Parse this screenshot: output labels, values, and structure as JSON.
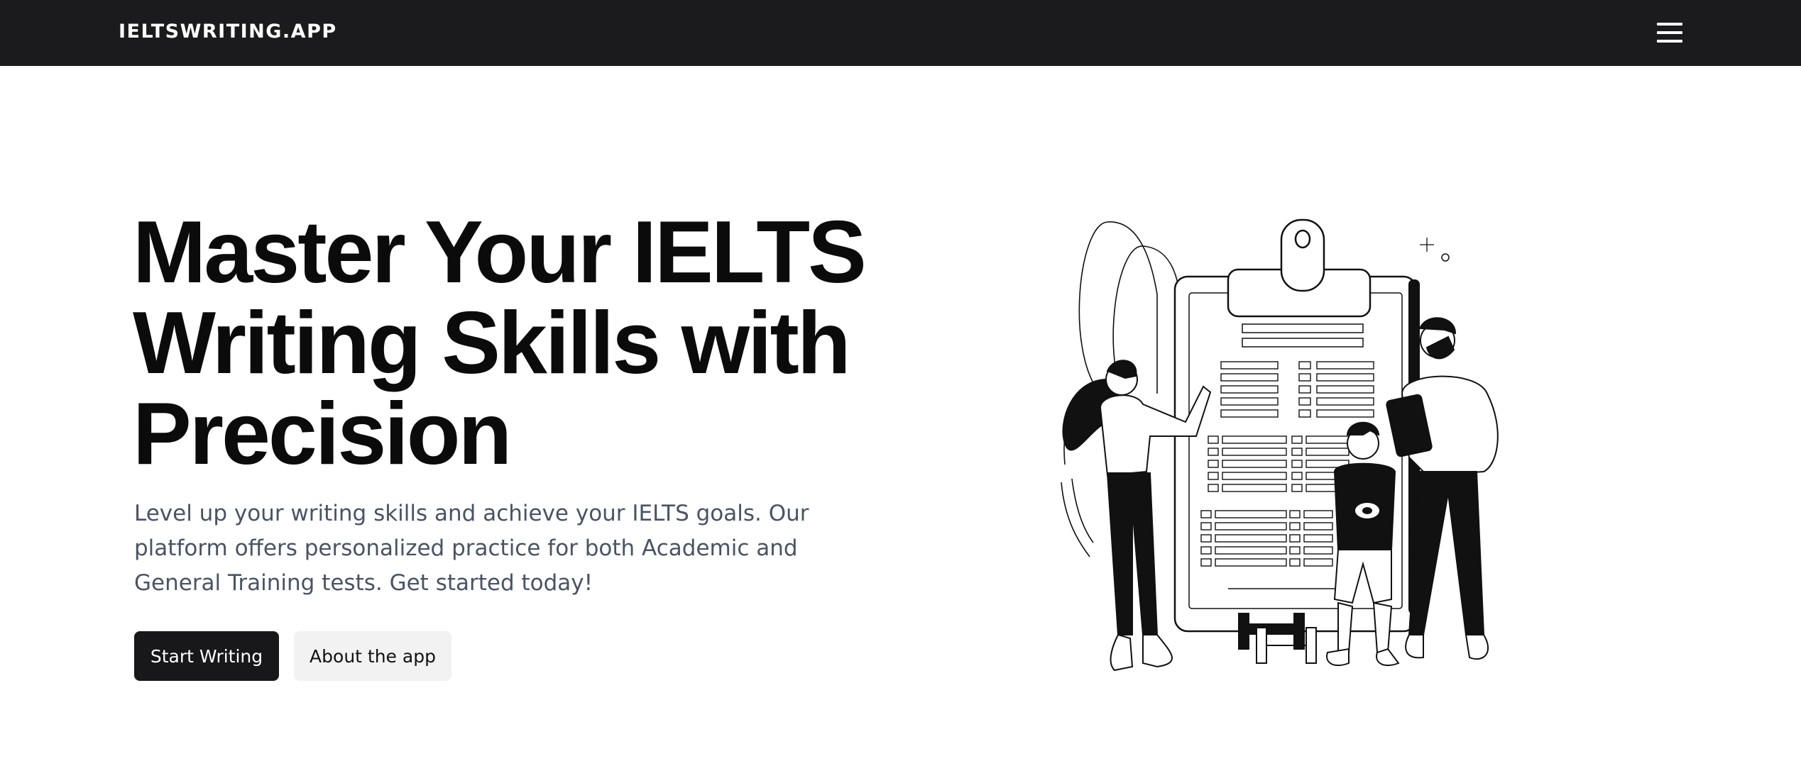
{
  "header": {
    "brand": "IELTSWRITING.APP",
    "menu_icon": "hamburger-menu-icon"
  },
  "hero": {
    "title": "Master Your IELTS Writing Skills with Precision",
    "subtitle": "Level up your writing skills and achieve your IELTS goals. Our platform offers personalized practice for both Academic and General Training tests. Get started today!",
    "primary_button": "Start Writing",
    "secondary_button": "About the app",
    "illustration": "people-with-clipboard-illustration"
  },
  "colors": {
    "header_bg": "#1b1b1d",
    "title": "#0b0b0c",
    "subtitle": "#4a5364",
    "primary_button_bg": "#18181b",
    "secondary_button_bg": "#f2f2f3"
  }
}
